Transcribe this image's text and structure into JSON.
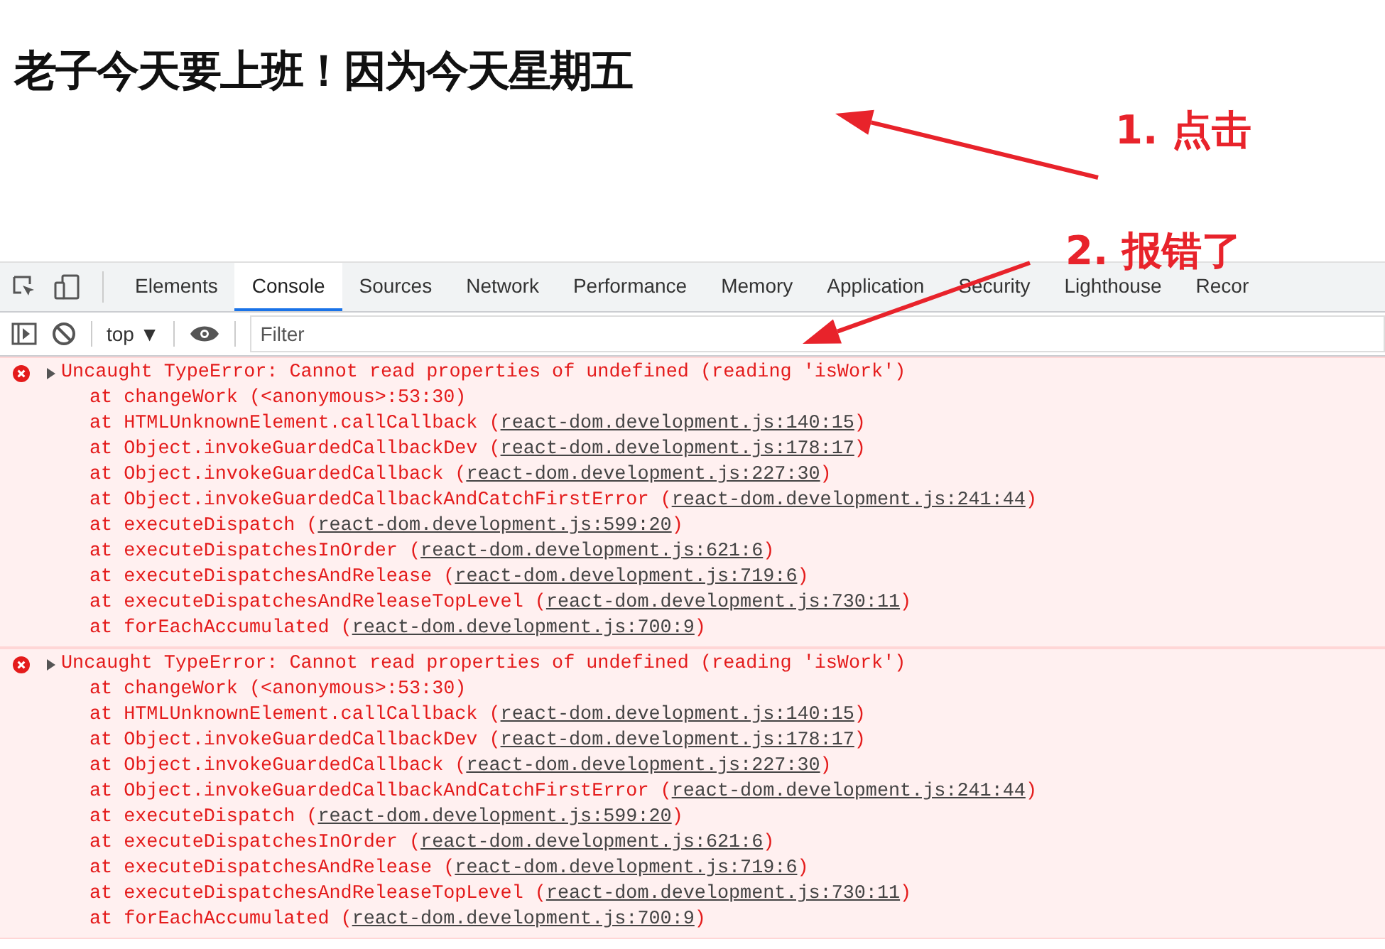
{
  "heading": "老子今天要上班！因为今天星期五",
  "annotations": [
    {
      "label": "1. 点击"
    },
    {
      "label": "2. 报错了"
    }
  ],
  "devtools": {
    "tabs": [
      {
        "label": "Elements",
        "selected": false
      },
      {
        "label": "Console",
        "selected": true
      },
      {
        "label": "Sources",
        "selected": false
      },
      {
        "label": "Network",
        "selected": false
      },
      {
        "label": "Performance",
        "selected": false
      },
      {
        "label": "Memory",
        "selected": false
      },
      {
        "label": "Application",
        "selected": false
      },
      {
        "label": "Security",
        "selected": false
      },
      {
        "label": "Lighthouse",
        "selected": false
      },
      {
        "label": "Recor",
        "selected": false
      }
    ],
    "context": "top ▼",
    "filter": {
      "placeholder": "Filter"
    }
  },
  "console": [
    {
      "message": "Uncaught TypeError: Cannot read properties of undefined (reading 'isWork')",
      "expanded": false,
      "frames": [
        {
          "text": "at changeWork (<anonymous>:53:30)"
        },
        {
          "text": "at HTMLUnknownElement.callCallback (",
          "link": "react-dom.development.js:140:15",
          "end": ")"
        },
        {
          "text": "at Object.invokeGuardedCallbackDev (",
          "link": "react-dom.development.js:178:17",
          "end": ")"
        },
        {
          "text": "at Object.invokeGuardedCallback (",
          "link": "react-dom.development.js:227:30",
          "end": ")"
        },
        {
          "text": "at Object.invokeGuardedCallbackAndCatchFirstError (",
          "link": "react-dom.development.js:241:44",
          "end": ")"
        },
        {
          "text": "at executeDispatch (",
          "link": "react-dom.development.js:599:20",
          "end": ")"
        },
        {
          "text": "at executeDispatchesInOrder (",
          "link": "react-dom.development.js:621:6",
          "end": ")"
        },
        {
          "text": "at executeDispatchesAndRelease (",
          "link": "react-dom.development.js:719:6",
          "end": ")"
        },
        {
          "text": "at executeDispatchesAndReleaseTopLevel (",
          "link": "react-dom.development.js:730:11",
          "end": ")"
        },
        {
          "text": "at forEachAccumulated (",
          "link": "react-dom.development.js:700:9",
          "end": ")"
        }
      ]
    },
    {
      "message": "Uncaught TypeError: Cannot read properties of undefined (reading 'isWork')",
      "expanded": false,
      "frames": [
        {
          "text": "at changeWork (<anonymous>:53:30)"
        },
        {
          "text": "at HTMLUnknownElement.callCallback (",
          "link": "react-dom.development.js:140:15",
          "end": ")"
        },
        {
          "text": "at Object.invokeGuardedCallbackDev (",
          "link": "react-dom.development.js:178:17",
          "end": ")"
        },
        {
          "text": "at Object.invokeGuardedCallback (",
          "link": "react-dom.development.js:227:30",
          "end": ")"
        },
        {
          "text": "at Object.invokeGuardedCallbackAndCatchFirstError (",
          "link": "react-dom.development.js:241:44",
          "end": ")"
        },
        {
          "text": "at executeDispatch (",
          "link": "react-dom.development.js:599:20",
          "end": ")"
        },
        {
          "text": "at executeDispatchesInOrder (",
          "link": "react-dom.development.js:621:6",
          "end": ")"
        },
        {
          "text": "at executeDispatchesAndRelease (",
          "link": "react-dom.development.js:719:6",
          "end": ")"
        },
        {
          "text": "at executeDispatchesAndReleaseTopLevel (",
          "link": "react-dom.development.js:730:11",
          "end": ")"
        },
        {
          "text": "at forEachAccumulated (",
          "link": "react-dom.development.js:700:9",
          "end": ")"
        }
      ]
    }
  ]
}
